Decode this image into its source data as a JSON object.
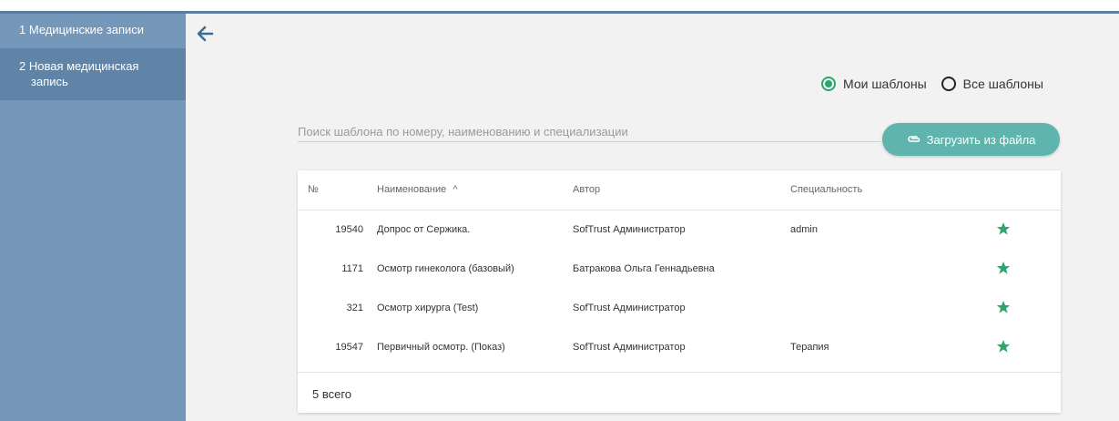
{
  "sidebar": {
    "items": [
      {
        "label": "1 Медицинские записи"
      },
      {
        "label": "2 Новая медицинская"
      },
      {
        "label": "запись"
      }
    ]
  },
  "filter": {
    "my_templates": "Мои шаблоны",
    "all_templates": "Все шаблоны",
    "selected": "my_templates"
  },
  "search": {
    "placeholder": "Поиск шаблона по номеру, наименованию и специализации",
    "value": ""
  },
  "upload_button": {
    "label": "Загрузить из файла"
  },
  "table": {
    "columns": {
      "num": "№",
      "name": "Наименование",
      "sort_indicator": "^",
      "author": "Автор",
      "specialty": "Специальность"
    },
    "rows": [
      {
        "num": "19540",
        "name": "Допрос от Сержика.",
        "author": "SofTrust Администратор",
        "specialty": "admin"
      },
      {
        "num": "1171",
        "name": "Осмотр гинеколога (базовый)",
        "author": "Батракова Ольга Геннадьевна",
        "specialty": ""
      },
      {
        "num": "321",
        "name": "Осмотр хирурга (Test)",
        "author": "SofTrust Администратор",
        "specialty": ""
      },
      {
        "num": "19547",
        "name": "Первичный осмотр. (Показ)",
        "author": "SofTrust Администратор",
        "specialty": "Терапия"
      }
    ],
    "total": "5 всего"
  },
  "icons": {
    "back": "arrow-left-icon",
    "upload": "paperclip-icon",
    "favorite": "star-icon"
  },
  "colors": {
    "sidebar": "#7598ba",
    "sidebar_active": "#5f84a8",
    "accent_green": "#2fa46f",
    "button_teal": "#5fb5ad",
    "back_arrow": "#3f6b97"
  }
}
